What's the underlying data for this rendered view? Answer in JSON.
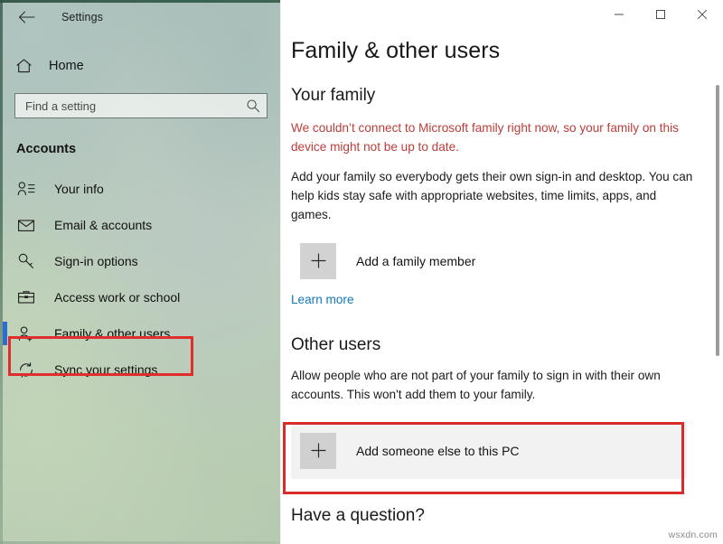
{
  "window": {
    "app_title": "Settings",
    "back_icon": "back-arrow-icon",
    "controls": {
      "minimize_label": "Minimize",
      "maximize_label": "Maximize",
      "close_label": "Close"
    }
  },
  "sidebar": {
    "home": {
      "label": "Home",
      "icon": "home-icon"
    },
    "search": {
      "placeholder": "Find a setting",
      "value": "",
      "icon": "search-icon"
    },
    "category": "Accounts",
    "items": [
      {
        "label": "Your info",
        "icon": "person-info-icon",
        "selected": false
      },
      {
        "label": "Email & accounts",
        "icon": "envelope-icon",
        "selected": false
      },
      {
        "label": "Sign-in options",
        "icon": "key-icon",
        "selected": false
      },
      {
        "label": "Access work or school",
        "icon": "briefcase-icon",
        "selected": false
      },
      {
        "label": "Family & other users",
        "icon": "person-add-icon",
        "selected": true
      },
      {
        "label": "Sync your settings",
        "icon": "sync-icon",
        "selected": false
      }
    ]
  },
  "main": {
    "page_title": "Family & other users",
    "your_family": {
      "heading": "Your family",
      "warning": "We couldn’t connect to Microsoft family right now, so your family on this device might not be up to date.",
      "description": "Add your family so everybody gets their own sign-in and desktop. You can help kids stay safe with appropriate websites, time limits, apps, and games.",
      "add_button_label": "Add a family member",
      "add_button_icon": "plus-icon",
      "learn_more_label": "Learn more"
    },
    "other_users": {
      "heading": "Other users",
      "description": "Allow people who are not part of your family to sign in with their own accounts. This won't add them to your family.",
      "add_button_label": "Add someone else to this PC",
      "add_button_icon": "plus-icon"
    },
    "bottom_heading": "Have a question?"
  },
  "annotations": {
    "color": "#e02d2d",
    "sidebar_target": "Family & other users",
    "content_target": "Add someone else to this PC"
  },
  "colors": {
    "accent_selection": "#2a6fd0",
    "warning_red": "#bb3d3a",
    "link_blue": "#1277bc",
    "annotation_red": "#e02d2d",
    "tile_gray": "#d2d2d2",
    "row_highlight": "#f2f2f2"
  },
  "watermark": "wsxdn.com"
}
